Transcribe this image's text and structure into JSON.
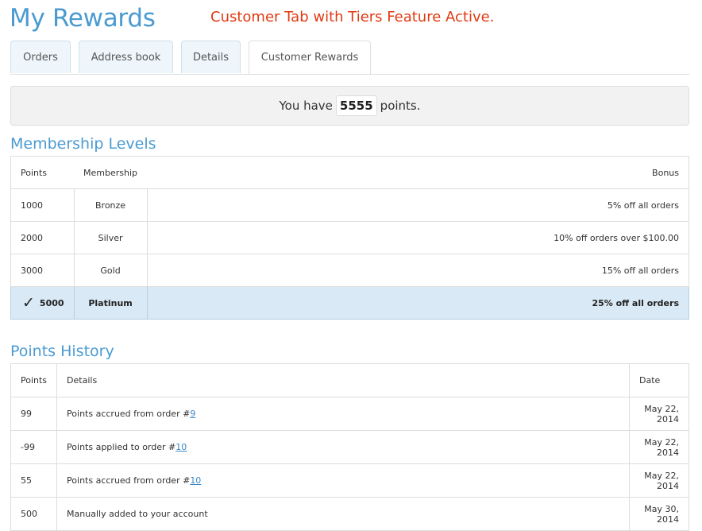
{
  "page": {
    "title": "My Rewards",
    "annotation": "Customer Tab with Tiers Feature Active."
  },
  "tabs": [
    "Orders",
    "Address book",
    "Details",
    "Customer Rewards"
  ],
  "active_tab": "Customer Rewards",
  "points_summary": {
    "prefix": "You have",
    "value": "5555",
    "suffix": "points."
  },
  "membership": {
    "title": "Membership Levels",
    "headers": {
      "points": "Points",
      "membership": "Membership",
      "bonus": "Bonus"
    },
    "current_mark": "✓",
    "rows": [
      {
        "points": "1000",
        "membership": "Bronze",
        "bonus": "5% off all orders"
      },
      {
        "points": "2000",
        "membership": "Silver",
        "bonus": "10% off orders over $100.00"
      },
      {
        "points": "3000",
        "membership": "Gold",
        "bonus": "15% off all orders"
      },
      {
        "points": "5000",
        "membership": "Platinum",
        "bonus": "25% off all orders"
      }
    ]
  },
  "history": {
    "title": "Points History",
    "headers": {
      "points": "Points",
      "details": "Details",
      "date": "Date"
    },
    "rows": [
      {
        "points": "99",
        "details": "Points accrued from order #",
        "link": "9",
        "date": "May 22, 2014"
      },
      {
        "points": "-99",
        "details": "Points applied to order #",
        "link": "10",
        "date": "May 22, 2014"
      },
      {
        "points": "55",
        "details": "Points accrued from order #",
        "link": "10",
        "date": "May 22, 2014"
      },
      {
        "points": "500",
        "details": "Manually added to your account",
        "link": "",
        "date": "May 30, 2014"
      }
    ]
  }
}
